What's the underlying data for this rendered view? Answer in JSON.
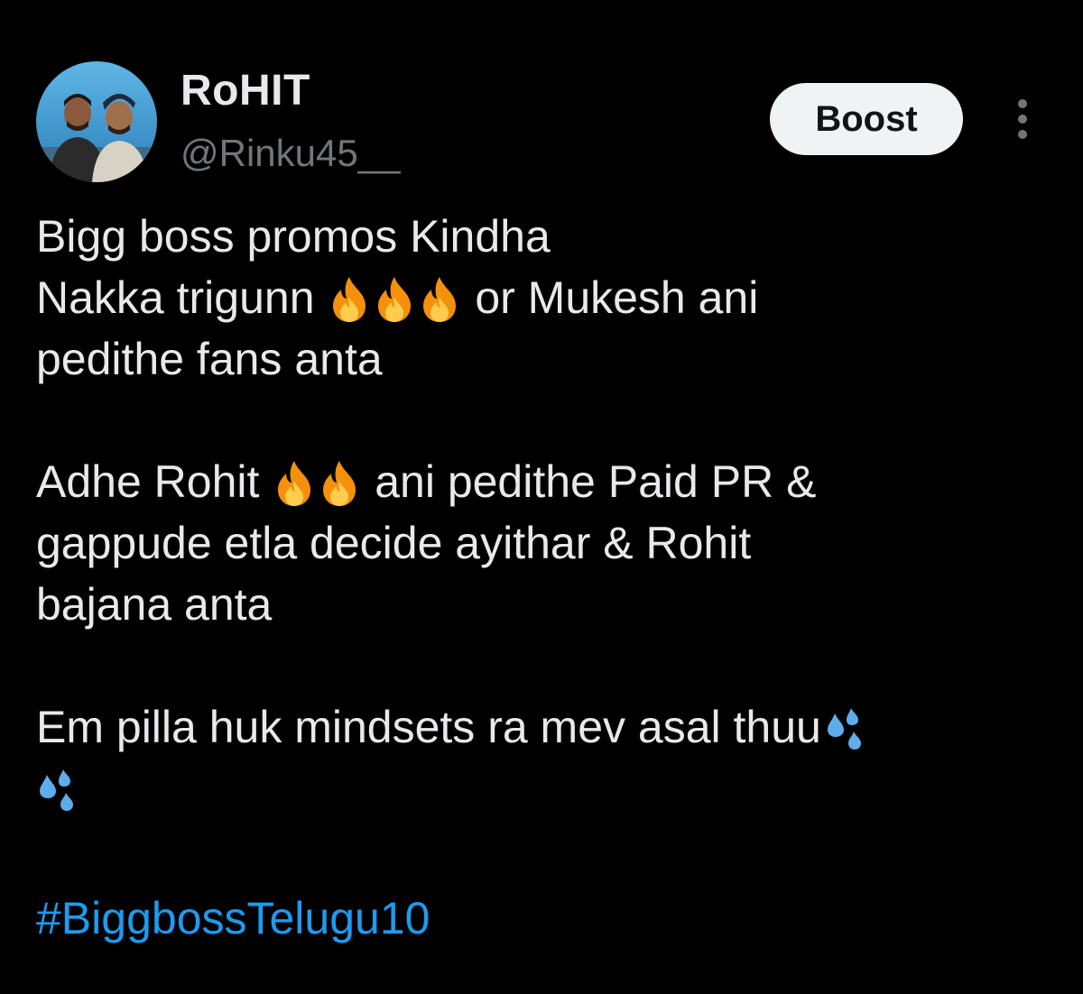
{
  "author": {
    "display_name": "RoHIT",
    "handle": "@Rinku45__",
    "avatar_icon": "profile-photo"
  },
  "actions": {
    "boost_label": "Boost",
    "more_icon": "more-vertical-icon"
  },
  "post": {
    "p1": {
      "l1": "Bigg boss promos Kindha",
      "l2a": "Nakka trigunn",
      "l2b": "or Mukesh ani",
      "l3": "pedithe fans anta"
    },
    "p2": {
      "l1a": "Adhe Rohit",
      "l1b": "ani pedithe Paid PR &",
      "l2": "gappude etla decide ayithar & Rohit",
      "l3": "bajana anta"
    },
    "p3": {
      "l1": "Em pilla  huk mindsets ra mev asal thuu"
    },
    "hashtag": "#BiggbossTelugu10"
  },
  "emoji": {
    "fire": "fire-emoji",
    "sweat": "sweat-droplets-emoji"
  },
  "colors": {
    "background": "#000000",
    "text": "#e7e9ea",
    "secondary": "#71767b",
    "link": "#1d9bf0",
    "button_bg": "#eff3f4"
  }
}
